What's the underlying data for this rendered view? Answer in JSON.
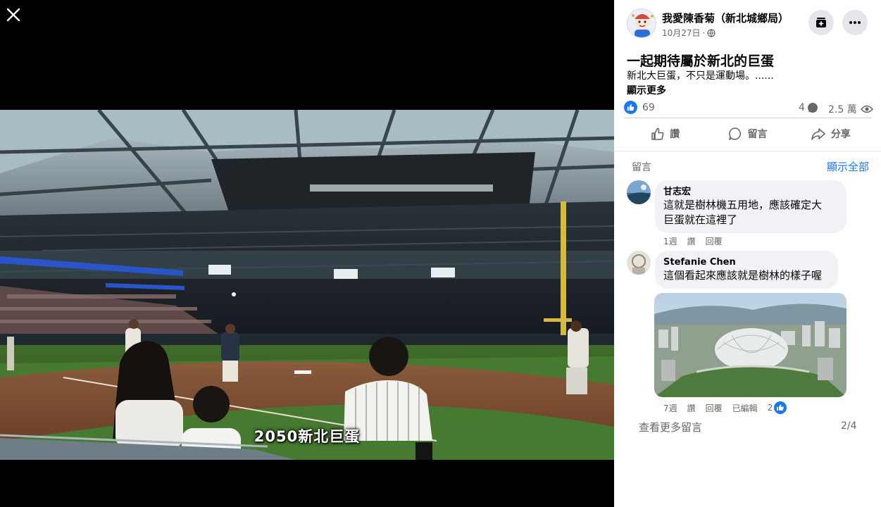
{
  "viewer": {
    "close_icon": "close-icon",
    "video_caption": "2050新北巨蛋"
  },
  "post": {
    "author": "我愛陳香菊（新北城鄉局）",
    "date": "10月27日",
    "privacy_icon": "globe-icon",
    "title": "一起期待屬於新北的巨蛋",
    "text": "新北大巨蛋，不只是運動場。......",
    "see_more": "顯示更多",
    "like_count": "69",
    "comment_count": "4",
    "view_count": "2.5 萬",
    "actions": {
      "like": "讚",
      "comment": "留言",
      "share": "分享"
    }
  },
  "comments_section": {
    "label": "留言",
    "show_all": "顯示全部",
    "items": [
      {
        "name": "甘志宏",
        "text_line1": "這就是樹林機五用地，應該確定大",
        "text_line2": "巨蛋就在這裡了",
        "time": "1週",
        "like": "讚",
        "reply": "回覆"
      },
      {
        "name": "Stefanie Chen",
        "text_line1": "這個看起來應該就是樹林的樣子喔",
        "time": "7週",
        "like": "讚",
        "reply": "回覆",
        "edited": "已編輯",
        "reaction_count": "2"
      }
    ],
    "view_more": "查看更多留言",
    "pager": "2/4"
  },
  "colors": {
    "accent": "#1877f2",
    "panel_bg": "#ffffff",
    "bubble_bg": "#f0f2f5",
    "secondary_text": "#65676b"
  }
}
